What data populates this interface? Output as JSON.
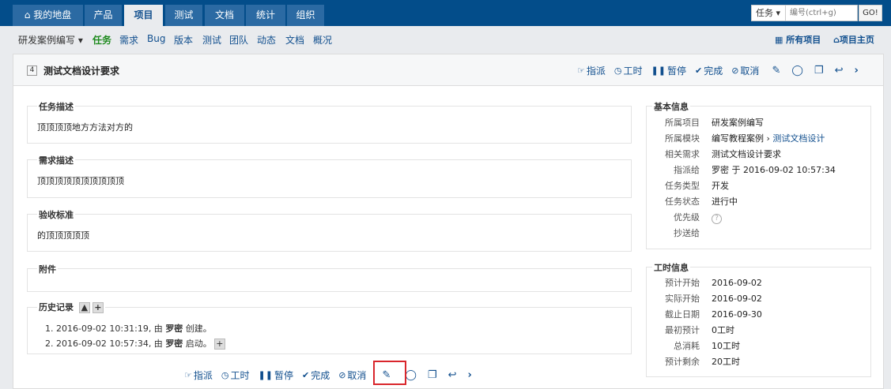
{
  "topnav": {
    "tabs": [
      {
        "label": "我的地盘",
        "icon": "home-icon"
      },
      {
        "label": "产品"
      },
      {
        "label": "项目",
        "active": true
      },
      {
        "label": "测试"
      },
      {
        "label": "文档"
      },
      {
        "label": "统计"
      },
      {
        "label": "组织"
      }
    ],
    "search_type": "任务",
    "search_placeholder": "编号(ctrl+g)",
    "go_label": "GO!"
  },
  "subnav": {
    "project": "研发案例编写",
    "items": [
      "任务",
      "需求",
      "Bug",
      "版本",
      "测试",
      "团队",
      "动态",
      "文档",
      "概况"
    ],
    "all_projects": "所有项目",
    "project_home": "项目主页"
  },
  "task": {
    "id": "4",
    "title": "测试文档设计要求"
  },
  "actions": {
    "assign": "指派",
    "effort": "工时",
    "pause": "暂停",
    "finish": "完成",
    "cancel": "取消"
  },
  "sections": {
    "desc_title": "任务描述",
    "desc": "顶顶顶顶地方方法对方的",
    "story_title": "需求描述",
    "story": "顶顶顶顶顶顶顶顶顶顶",
    "verify_title": "验收标准",
    "verify": "的顶顶顶顶顶",
    "files_title": "附件",
    "history_title": "历史记录"
  },
  "history": [
    {
      "pre": "1. 2016-09-02 10:31:19, 由 ",
      "user": "罗密",
      "post": " 创建。"
    },
    {
      "pre": "2. 2016-09-02 10:57:34, 由 ",
      "user": "罗密",
      "post": " 启动。"
    }
  ],
  "basic": {
    "title": "基本信息",
    "rows": [
      {
        "k": "所属项目",
        "v": "研发案例编写"
      },
      {
        "k": "所属模块",
        "v": "编写教程案例 › ",
        "v2": "测试文档设计"
      },
      {
        "k": "相关需求",
        "v": "测试文档设计要求"
      },
      {
        "k": "指派给",
        "v": "罗密 于 2016-09-02 10:57:34"
      },
      {
        "k": "任务类型",
        "v": "开发"
      },
      {
        "k": "任务状态",
        "v": "进行中"
      },
      {
        "k": "优先级",
        "v": "?"
      },
      {
        "k": "抄送给",
        "v": ""
      }
    ]
  },
  "effort_info": {
    "title": "工时信息",
    "rows": [
      {
        "k": "预计开始",
        "v": "2016-09-02"
      },
      {
        "k": "实际开始",
        "v": "2016-09-02"
      },
      {
        "k": "截止日期",
        "v": "2016-09-30"
      },
      {
        "k": "最初预计",
        "v": "0工时"
      },
      {
        "k": "总消耗",
        "v": "10工时"
      },
      {
        "k": "预计剩余",
        "v": "20工时"
      }
    ]
  },
  "colors": {
    "nav": "#034d8a",
    "accent": "#114f8e",
    "highlight": "#d9262c"
  }
}
